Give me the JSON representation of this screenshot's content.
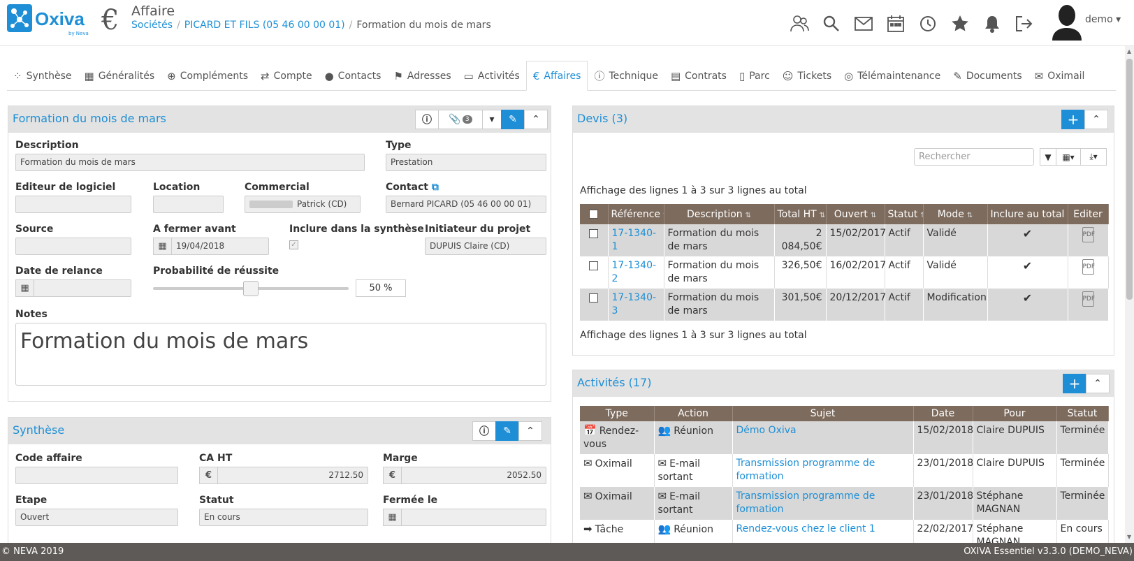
{
  "header": {
    "logo_text": "Oxiva",
    "logo_sub": "by Neva",
    "page_title": "Affaire",
    "breadcrumb": [
      "Sociétés",
      "PICARD ET FILS (05 46 00 00 01)",
      "Formation du mois de mars"
    ],
    "user_name": "demo",
    "icons": [
      "users-icon",
      "search-icon",
      "mail-icon",
      "calendar-icon",
      "history-icon",
      "star-icon",
      "bell-icon",
      "logout-icon"
    ]
  },
  "tabs": [
    {
      "name": "synthese",
      "label": "Synthèse",
      "icon": "⁘"
    },
    {
      "name": "generalites",
      "label": "Généralités",
      "icon": "▦"
    },
    {
      "name": "complements",
      "label": "Compléments",
      "icon": "⊕"
    },
    {
      "name": "compte",
      "label": "Compte",
      "icon": "⇄"
    },
    {
      "name": "contacts",
      "label": "Contacts",
      "icon": "●"
    },
    {
      "name": "adresses",
      "label": "Adresses",
      "icon": "⚑"
    },
    {
      "name": "activites",
      "label": "Activités",
      "icon": "▭"
    },
    {
      "name": "affaires",
      "label": "Affaires",
      "icon": "€"
    },
    {
      "name": "technique",
      "label": "Technique",
      "icon": "ⓘ"
    },
    {
      "name": "contrats",
      "label": "Contrats",
      "icon": "▤"
    },
    {
      "name": "parc",
      "label": "Parc",
      "icon": "▯"
    },
    {
      "name": "tickets",
      "label": "Tickets",
      "icon": "☺"
    },
    {
      "name": "telemaintenance",
      "label": "Télémaintenance",
      "icon": "◎"
    },
    {
      "name": "documents",
      "label": "Documents",
      "icon": "✎"
    },
    {
      "name": "oximail",
      "label": "Oximail",
      "icon": "✉"
    }
  ],
  "active_tab": "Affaires",
  "affaire": {
    "title": "Formation du mois de mars",
    "attachments_count": "3",
    "labels": {
      "description": "Description",
      "type": "Type",
      "editeur": "Editeur de logiciel",
      "location": "Location",
      "commercial": "Commercial",
      "contact": "Contact",
      "source": "Source",
      "fermer_avant": "A fermer avant",
      "inclure": "Inclure dans la synthèse",
      "initiateur": "Initiateur du projet",
      "date_relance": "Date de relance",
      "probabilite": "Probabilité de réussite",
      "notes": "Notes"
    },
    "values": {
      "description": "Formation du mois de mars",
      "type": "Prestation",
      "editeur": "",
      "location": "",
      "commercial": "Patrick (CD)",
      "contact": "Bernard PICARD (05 46 00 00 01)",
      "source": "",
      "fermer_avant": "19/04/2018",
      "initiateur": "DUPUIS Claire (CD)",
      "date_relance": "",
      "probabilite": "50 %",
      "notes": "Formation du mois de mars"
    },
    "probabilite_value": 50
  },
  "synthese": {
    "title": "Synthèse",
    "labels": {
      "code": "Code affaire",
      "ca": "CA HT",
      "marge": "Marge",
      "etape": "Etape",
      "statut": "Statut",
      "fermee": "Fermée le"
    },
    "values": {
      "code": "",
      "ca": "2712.50",
      "marge": "2052.50",
      "etape": "Ouvert",
      "statut": "En cours",
      "fermee": ""
    }
  },
  "devis": {
    "title": "Devis (3)",
    "search_placeholder": "Rechercher",
    "info_top": "Affichage des lignes 1 à 3 sur 3 lignes au total",
    "info_bottom": "Affichage des lignes 1 à 3 sur 3 lignes au total",
    "columns": [
      "Référence",
      "Description",
      "Total HT",
      "Ouvert",
      "Statut",
      "Mode",
      "Inclure au total",
      "Editer"
    ],
    "rows": [
      {
        "ref": "17-1340-1",
        "description": "Formation du mois de mars",
        "total": "2 084,50€",
        "ouvert": "15/02/2017",
        "statut": "Actif",
        "mode": "Validé"
      },
      {
        "ref": "17-1340-2",
        "description": "Formation du mois de mars",
        "total": "326,50€",
        "ouvert": "16/02/2017",
        "statut": "Actif",
        "mode": "Validé"
      },
      {
        "ref": "17-1340-3",
        "description": "Formation du mois de mars",
        "total": "301,50€",
        "ouvert": "20/12/2017",
        "statut": "Actif",
        "mode": "Modification"
      }
    ]
  },
  "activites": {
    "title": "Activités (17)",
    "columns": [
      "Type",
      "Action",
      "Sujet",
      "Date",
      "Pour",
      "Statut"
    ],
    "rows": [
      {
        "type": "Rendez-vous",
        "type_icon": "calendar-note-icon",
        "action": "Réunion",
        "action_icon": "meeting-icon",
        "sujet": "Démo Oxiva",
        "date": "15/02/2018",
        "pour": "Claire DUPUIS",
        "statut": "Terminée"
      },
      {
        "type": "Oximail",
        "type_icon": "mail-icon",
        "action": "E-mail sortant",
        "action_icon": "mail-out-icon",
        "sujet": "Transmission programme de formation",
        "date": "23/01/2018",
        "pour": "Claire DUPUIS",
        "statut": "Terminée"
      },
      {
        "type": "Oximail",
        "type_icon": "mail-icon",
        "action": "E-mail sortant",
        "action_icon": "mail-out-icon",
        "sujet": "Transmission programme de formation",
        "date": "23/01/2018",
        "pour": "Stéphane MAGNAN",
        "statut": "Terminée"
      },
      {
        "type": "Tâche",
        "type_icon": "arrow-task-icon",
        "action": "Réunion",
        "action_icon": "meeting-icon",
        "sujet": "Rendez-vous chez le client 1",
        "date": "22/02/2017",
        "pour": "Stéphane MAGNAN",
        "statut": "En cours"
      }
    ]
  },
  "footer": {
    "left": "© NEVA 2019",
    "right": "OXIVA Essentiel v3.3.0 (DEMO_NEVA)"
  }
}
